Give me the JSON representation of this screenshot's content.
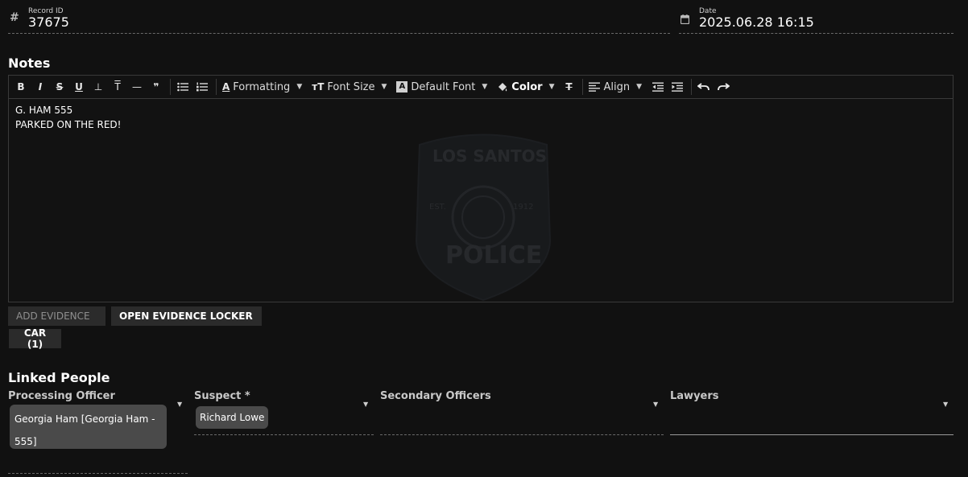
{
  "record": {
    "icon": "hash-icon",
    "label": "Record ID",
    "value": "37675"
  },
  "date": {
    "icon": "calendar-icon",
    "label": "Date",
    "value": "2025.06.28 16:15"
  },
  "notes": {
    "title": "Notes",
    "toolbar": {
      "bold": "B",
      "italic": "I",
      "strike": "S",
      "underline": "U",
      "subscript": "⊥",
      "superscript": "T",
      "hr": "—",
      "quote": "❞",
      "formatting": "Formatting",
      "font_size": "Font Size",
      "default_font": "Default Font",
      "color": "Color",
      "align": "Align"
    },
    "content": {
      "line1": "G. HAM 555",
      "line2": "PARKED ON THE RED!"
    },
    "watermark": {
      "top": "LOS SANTOS",
      "est_left": "EST.",
      "est_right": "1912",
      "bottom": "POLICE"
    }
  },
  "evidence": {
    "add_label": "ADD EVIDENCE",
    "open_locker_label": "OPEN EVIDENCE LOCKER",
    "car_label": "CAR (1)"
  },
  "linked_people": {
    "title": "Linked People",
    "processing_officer": {
      "label": "Processing Officer",
      "chip": "Georgia Ham [Georgia Ham - 555]"
    },
    "suspect": {
      "label": "Suspect *",
      "chip": "Richard Lowe"
    },
    "secondary_officers": {
      "label": "Secondary Officers"
    },
    "lawyers": {
      "label": "Lawyers"
    }
  },
  "colors": {
    "background": "#111111",
    "button": "#2b2b2b",
    "chip": "#4a4a4a"
  }
}
